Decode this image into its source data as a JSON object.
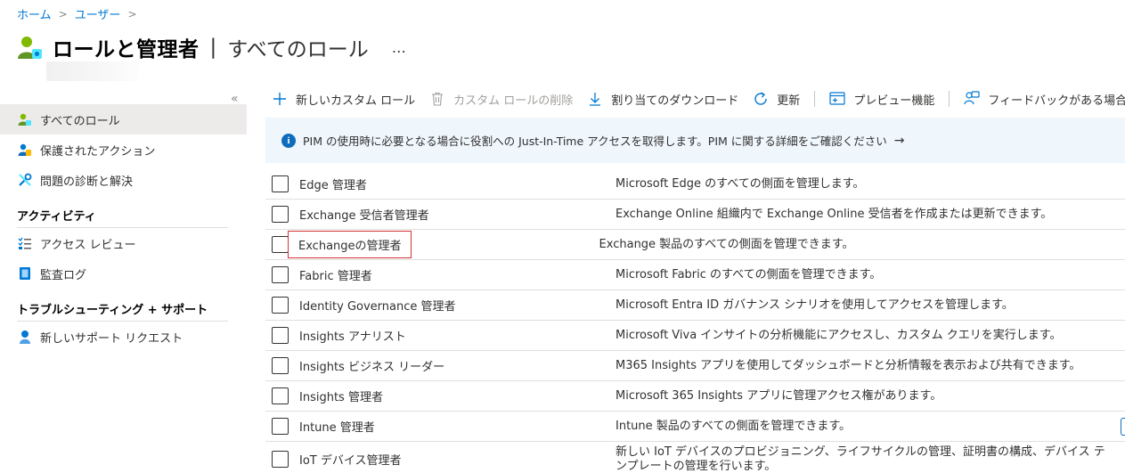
{
  "breadcrumb": {
    "home": "ホーム",
    "users": "ユーザー"
  },
  "header": {
    "title": "ロールと管理者",
    "separator": "|",
    "subtitle": "すべてのロール",
    "more": "…",
    "icon": "users-roles-icon"
  },
  "sidebar": {
    "collapse": "«",
    "items": [
      {
        "label": "すべてのロール",
        "icon": "roles-icon",
        "active": true
      },
      {
        "label": "保護されたアクション",
        "icon": "protected-actions-icon"
      },
      {
        "label": "問題の診断と解決",
        "icon": "wrench-icon"
      }
    ],
    "sections": [
      {
        "title": "アクティビティ",
        "items": [
          {
            "label": "アクセス レビュー",
            "icon": "access-review-icon"
          },
          {
            "label": "監査ログ",
            "icon": "audit-log-icon"
          }
        ]
      },
      {
        "title": "トラブルシューティング + サポート",
        "items": [
          {
            "label": "新しいサポート リクエスト",
            "icon": "support-icon"
          }
        ]
      }
    ]
  },
  "toolbar": {
    "new_role": "新しいカスタム ロール",
    "delete_role": "カスタム ロールの削除",
    "download": "割り当てのダウンロード",
    "refresh": "更新",
    "preview": "プレビュー機能",
    "feedback": "フィードバックがある場合"
  },
  "banner": {
    "text": "PIM の使用時に必要となる場合に役割への Just-In-Time アクセスを取得します。PIM に関する詳細をご確認ください",
    "arrow": "→"
  },
  "roles": [
    {
      "name": "Edge 管理者",
      "desc": "Microsoft Edge のすべての側面を管理します。"
    },
    {
      "name": "Exchange 受信者管理者",
      "desc": "Exchange Online 組織内で Exchange Online 受信者を作成または更新できます。"
    },
    {
      "name": "Exchangeの管理者",
      "desc": "Exchange 製品のすべての側面を管理できます。",
      "highlighted": true
    },
    {
      "name": "Fabric 管理者",
      "desc": "Microsoft Fabric のすべての側面を管理できます。"
    },
    {
      "name": "Identity Governance 管理者",
      "desc": "Microsoft Entra ID ガバナンス シナリオを使用してアクセスを管理します。"
    },
    {
      "name": "Insights アナリスト",
      "desc": "Microsoft Viva インサイトの分析機能にアクセスし、カスタム クエリを実行します。"
    },
    {
      "name": "Insights ビジネス リーダー",
      "desc": "M365 Insights アプリを使用してダッシュボードと分析情報を表示および共有できます。"
    },
    {
      "name": "Insights 管理者",
      "desc": "Microsoft 365 Insights アプリに管理アクセス権があります。"
    },
    {
      "name": "Intune 管理者",
      "desc": "Intune 製品のすべての側面を管理できます。"
    },
    {
      "name": "IoT デバイス管理者",
      "desc": "新しい IoT デバイスのプロビジョニング、ライフサイクルの管理、証明書の構成、デバイス テンプレートの管理を行います。"
    }
  ],
  "colors": {
    "accent": "#0078d4",
    "banner_bg": "#eff6fc",
    "highlight": "#d13438",
    "active_nav": "#edebe9"
  }
}
